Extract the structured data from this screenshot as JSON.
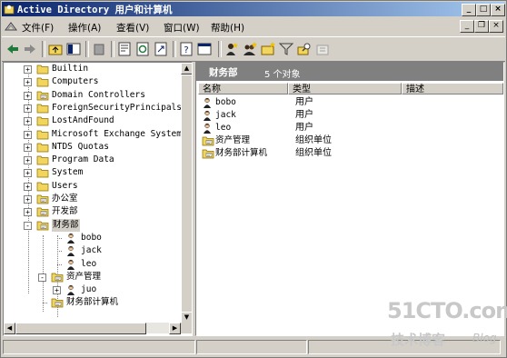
{
  "window": {
    "title": "Active Directory 用户和计算机"
  },
  "menubar": {
    "items": [
      "文件(F)",
      "操作(A)",
      "查看(V)",
      "窗口(W)",
      "帮助(H)"
    ]
  },
  "tree": {
    "nodes": [
      {
        "label": "Builtin",
        "icon": "folder-icon"
      },
      {
        "label": "Computers",
        "icon": "folder-icon"
      },
      {
        "label": "Domain Controllers",
        "icon": "ou-folder-icon"
      },
      {
        "label": "ForeignSecurityPrincipals",
        "icon": "folder-icon"
      },
      {
        "label": "LostAndFound",
        "icon": "folder-icon"
      },
      {
        "label": "Microsoft Exchange System",
        "icon": "folder-icon"
      },
      {
        "label": "NTDS Quotas",
        "icon": "folder-icon"
      },
      {
        "label": "Program Data",
        "icon": "folder-icon"
      },
      {
        "label": "System",
        "icon": "folder-icon"
      },
      {
        "label": "Users",
        "icon": "folder-icon"
      },
      {
        "label": "办公室",
        "icon": "ou-folder-icon"
      },
      {
        "label": "开发部",
        "icon": "ou-folder-icon"
      },
      {
        "label": "财务部",
        "icon": "ou-folder-icon"
      },
      {
        "label": "bobo",
        "icon": "user-icon"
      },
      {
        "label": "jack",
        "icon": "user-icon"
      },
      {
        "label": "leo",
        "icon": "user-icon"
      },
      {
        "label": "资产管理",
        "icon": "ou-folder-icon"
      },
      {
        "label": "juo",
        "icon": "user-icon"
      },
      {
        "label": "财务部计算机",
        "icon": "ou-folder-icon"
      }
    ]
  },
  "details": {
    "title": "财务部",
    "count": "5 个对象",
    "columns": [
      "名称",
      "类型",
      "描述"
    ],
    "rows": [
      {
        "name": "bobo",
        "type": "用户",
        "icon": "user-icon"
      },
      {
        "name": "jack",
        "type": "用户",
        "icon": "user-icon"
      },
      {
        "name": "leo",
        "type": "用户",
        "icon": "user-icon"
      },
      {
        "name": "资产管理",
        "type": "组织单位",
        "icon": "ou-folder-icon"
      },
      {
        "name": "财务部计算机",
        "type": "组织单位",
        "icon": "ou-folder-icon"
      }
    ]
  },
  "watermark": {
    "site": "51CTO.com",
    "tagline": "技术博客",
    "blog": "Blog"
  },
  "colors": {
    "title_start": "#0a246a",
    "title_end": "#a6caf0",
    "header_bg": "#808080",
    "folder": "#f2d55c"
  }
}
